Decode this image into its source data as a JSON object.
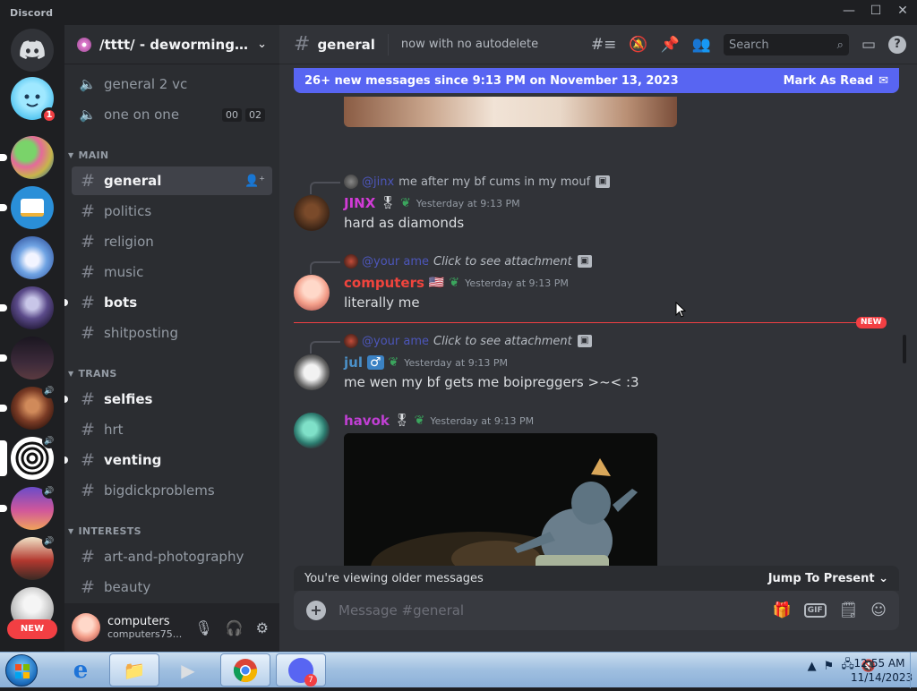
{
  "window": {
    "app_name": "Discord",
    "controls": [
      "—",
      "☐",
      "✕"
    ]
  },
  "rail": {
    "home_badge": "1",
    "new_label": "NEW"
  },
  "guild": {
    "name": "/tttt/ - deworming cli..."
  },
  "sidebar": {
    "voice_channels": [
      {
        "label": "general 2 vc"
      },
      {
        "label": "one on one",
        "tags": [
          "00",
          "02"
        ]
      }
    ],
    "categories": [
      {
        "label": "MAIN"
      },
      {
        "label": "TRANS"
      },
      {
        "label": "INTERESTS"
      }
    ],
    "channels": [
      {
        "label": "general"
      },
      {
        "label": "politics"
      },
      {
        "label": "religion"
      },
      {
        "label": "music"
      },
      {
        "label": "bots"
      },
      {
        "label": "shitposting"
      },
      {
        "label": "selfies"
      },
      {
        "label": "hrt"
      },
      {
        "label": "venting"
      },
      {
        "label": "bigdickproblems"
      },
      {
        "label": "art-and-photography"
      },
      {
        "label": "beauty"
      }
    ]
  },
  "user_panel": {
    "name": "computers",
    "tag": "computers75..."
  },
  "header": {
    "channel": "general",
    "topic": "now with no autodelete",
    "search_placeholder": "Search"
  },
  "new_banner": {
    "text": "26+ new messages since 9:13 PM on November 13, 2023",
    "action": "Mark As Read"
  },
  "messages": [
    {
      "reply_name": "@jinx",
      "reply_text": "me after my bf cums in my mouf",
      "author": "JINX",
      "author_color": "#d13bd6",
      "time": "Yesterday at 9:13 PM",
      "text": "hard as diamonds"
    },
    {
      "reply_name": "@your ame",
      "reply_text": "Click to see attachment",
      "author": "computers",
      "author_color": "#f0443d",
      "flag": "🇺🇸",
      "time": "Yesterday at 9:13 PM",
      "text": "literally me"
    },
    {
      "reply_name": "@your ame",
      "reply_text": "Click to see attachment",
      "author": "jul",
      "author_color": "#4b90c8",
      "gender": "♂",
      "time": "Yesterday at 9:13 PM",
      "text": "me wen my bf gets me boipreggers >~< :3"
    },
    {
      "author": "havok",
      "author_color": "#c03fd3",
      "time": "Yesterday at 9:13 PM"
    }
  ],
  "new_divider": "NEW",
  "older_bar": {
    "text": "You're viewing older messages",
    "jump": "Jump To Present"
  },
  "composer": {
    "placeholder": "Message #general",
    "gif": "GIF"
  },
  "taskbar": {
    "time": "12:55 AM",
    "date": "11/14/2023",
    "discord_badge": "7"
  },
  "colors": {
    "accent": "#5865f2",
    "danger": "#f23f43",
    "bg_main": "#313338",
    "bg_sidebar": "#2b2d31",
    "bg_rail": "#1e1f22"
  }
}
